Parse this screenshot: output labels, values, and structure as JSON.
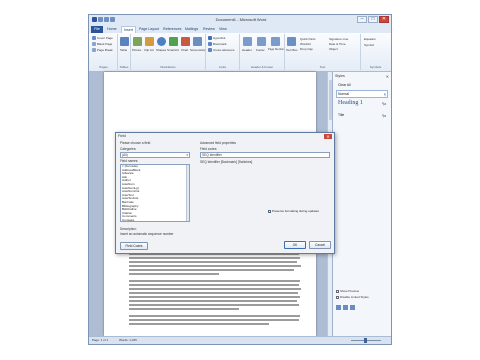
{
  "window": {
    "title": "Document1 - Microsoft Word",
    "controls": {
      "minimize": "–",
      "maximize": "□",
      "close": "✕"
    }
  },
  "ribbon": {
    "file_tab": "File",
    "tabs": [
      "Home",
      "Insert",
      "Page Layout",
      "References",
      "Mailings",
      "Review",
      "View"
    ],
    "active_tab": "Insert",
    "groups": {
      "pages": {
        "label": "Pages",
        "items": [
          "Cover Page",
          "Blank Page",
          "Page Break"
        ]
      },
      "tables": {
        "label": "Tables",
        "items": [
          "Table"
        ]
      },
      "illustrations": {
        "label": "Illustrations",
        "items": [
          "Picture",
          "Clip Art",
          "Shapes",
          "SmartArt",
          "Chart",
          "Screenshot"
        ]
      },
      "links": {
        "label": "Links",
        "items": [
          "Hyperlink",
          "Bookmark",
          "Cross-reference"
        ]
      },
      "header_footer": {
        "label": "Header & Footer",
        "items": [
          "Header",
          "Footer",
          "Page Number"
        ]
      },
      "text": {
        "label": "Text",
        "items": [
          "Text Box",
          "Quick Parts",
          "WordArt",
          "Drop Cap",
          "Signature Line",
          "Date & Time",
          "Object"
        ]
      },
      "symbols": {
        "label": "Symbols",
        "items": [
          "Equation",
          "Symbol"
        ]
      }
    }
  },
  "document": {
    "left_fragments": [
      "In the tab",
      "to the",
      "Quick tabl",
      "Styles tab",
      "Document",
      "Lists ad bu",
      "as to your",
      "appears in",
      "Figure ta",
      "You'll be",
      "SkeWell and"
    ]
  },
  "styles_pane": {
    "title": "Styles",
    "items": [
      {
        "label": "Clear All",
        "heading": false
      },
      {
        "label": "Normal",
        "heading": false
      },
      {
        "label": "Heading 1",
        "heading": true
      },
      {
        "label": "Title",
        "heading": false
      }
    ],
    "show_preview": "Show Preview",
    "disable_linked": "Disable Linked Styles"
  },
  "status": {
    "page": "Page: 1 of 1",
    "words": "Words: 1,025"
  },
  "dialog": {
    "title": "Field",
    "choose_label": "Please choose a field",
    "categories_label": "Categories:",
    "category_value": "(All)",
    "field_names_label": "Field names:",
    "field_names": [
      "= (Formula)",
      "AddressBlock",
      "Advance",
      "Ask",
      "Author",
      "AutoNum",
      "AutoNumLgl",
      "AutoNumOut",
      "AutoText",
      "AutoTextList",
      "BarCode",
      "Bibliography",
      "BidiOutline",
      "Citation",
      "Comments",
      "Compare",
      "CreateDate",
      "Database",
      "Date",
      "DocProperty",
      "DocVariable",
      "EditTime",
      "Eq",
      "FileName",
      "FileSize",
      "Fill-in",
      "GoToButton",
      "GreetingLine",
      "Hyperlink"
    ],
    "selected_field": "DocVariable",
    "description_label": "Description:",
    "description_text": "Insert an automatic sequence number",
    "field_codes_button": "Field Codes",
    "advanced_label": "Advanced field properties",
    "field_codes_label": "Field codes:",
    "field_code_value": "SEQ Identifier [Bookmark] [Switches]",
    "example_value": "SEQ Identifier",
    "preserve_label": "Preserve formatting during updates",
    "ok_button": "OK",
    "cancel_button": "Cancel"
  }
}
